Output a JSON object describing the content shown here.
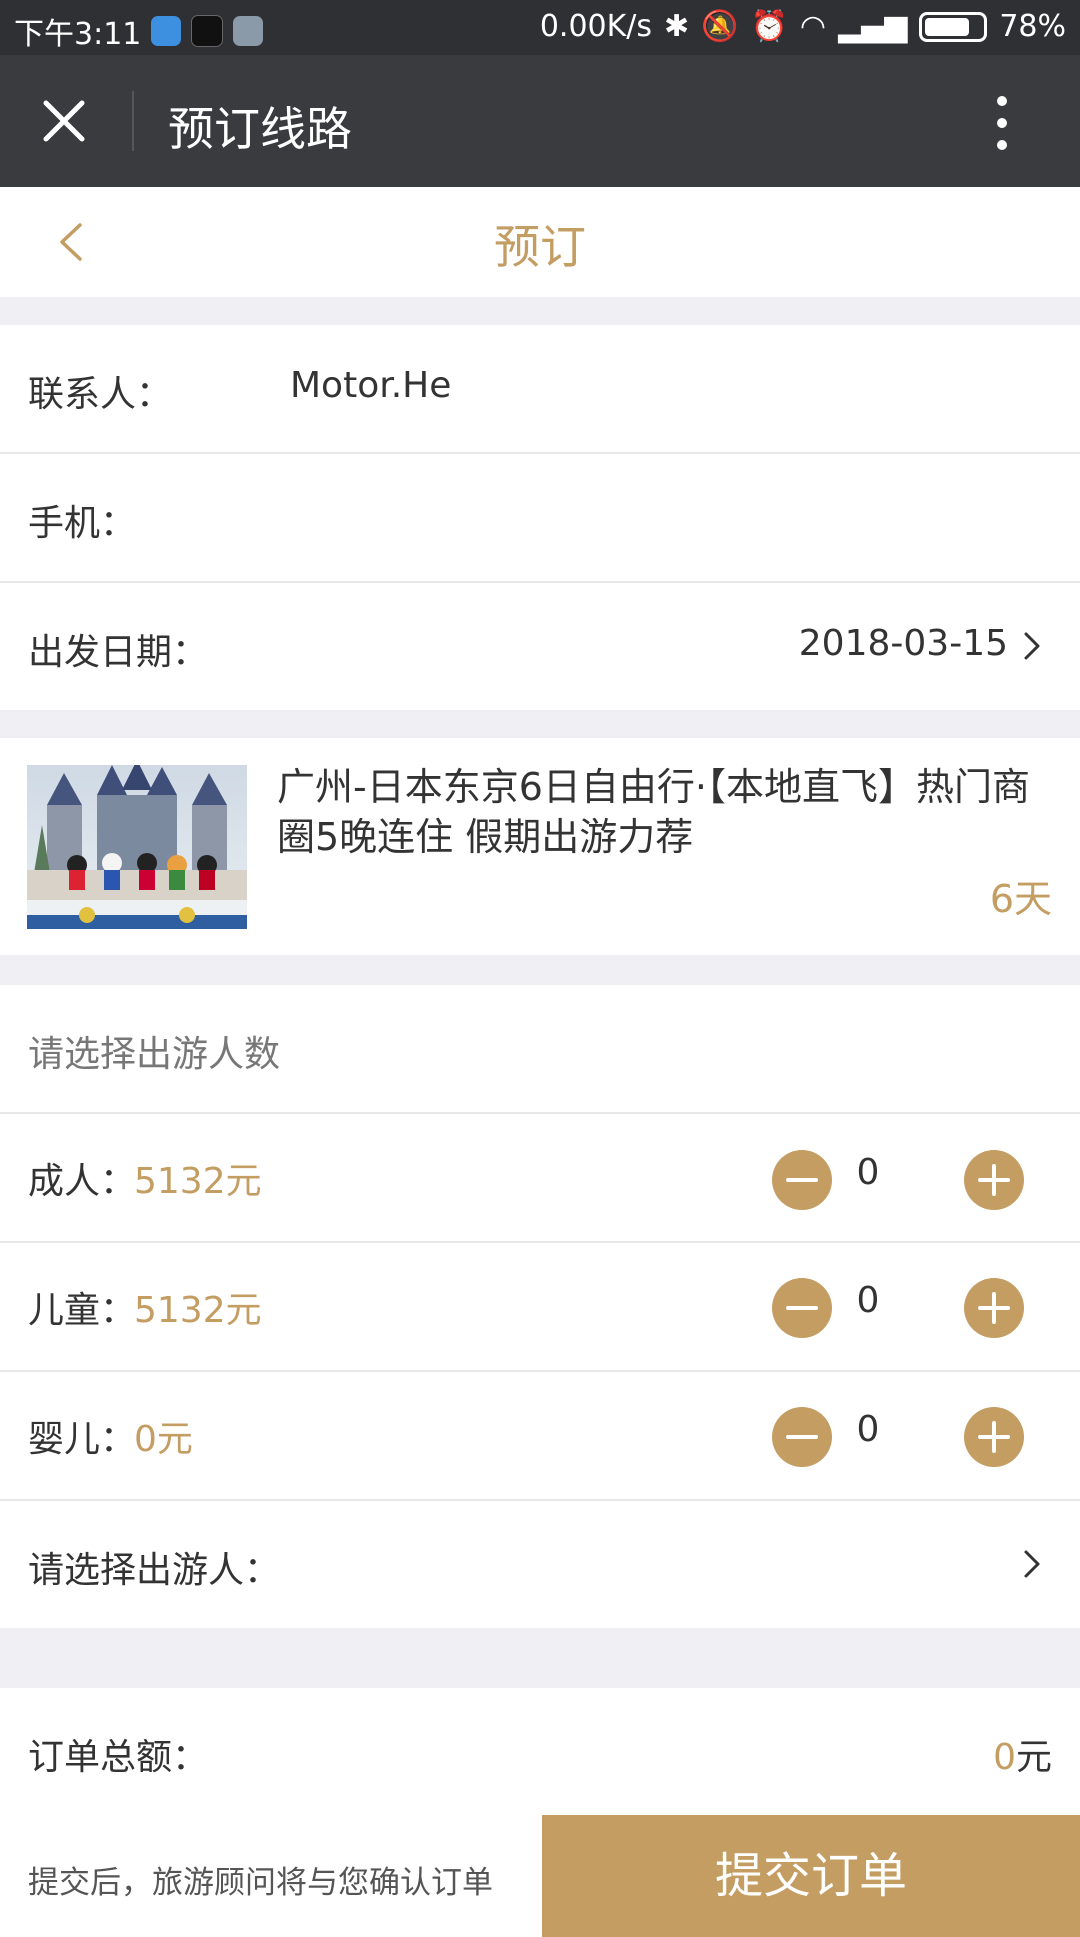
{
  "status_bar": {
    "time": "下午3:11",
    "speed": "0.00K/s",
    "battery": "78%",
    "app_icons": [
      "cloud-app-icon",
      "tiktok-app-icon",
      "notes-app-icon"
    ]
  },
  "wechat_bar": {
    "title": "预订线路"
  },
  "nav": {
    "title": "预订"
  },
  "contact": {
    "label": "联系人：",
    "value": "Motor.He"
  },
  "phone": {
    "label": "手机：",
    "value": ""
  },
  "departure": {
    "label": "出发日期：",
    "value": "2018-03-15"
  },
  "product": {
    "title": "广州-日本东京6日自由行·【本地直飞】热门商圈5晚连住 假期出游力荐",
    "duration": "6天"
  },
  "travelers": {
    "heading": "请选择出游人数",
    "items": [
      {
        "label": "成人：",
        "price": "5132元",
        "count": "0"
      },
      {
        "label": "儿童：",
        "price": "5132元",
        "count": "0"
      },
      {
        "label": "婴儿：",
        "price": "0元",
        "count": "0"
      }
    ],
    "select_label": "请选择出游人："
  },
  "order": {
    "total_label": "订单总额：",
    "total_amount": "0",
    "total_unit": "元",
    "note": "提交后，旅游顾问将与您确认订单",
    "submit_label": "提交订单"
  },
  "colors": {
    "accent": "#c49d62",
    "bar_dark": "#3a3b3f",
    "background": "#efeff4"
  }
}
